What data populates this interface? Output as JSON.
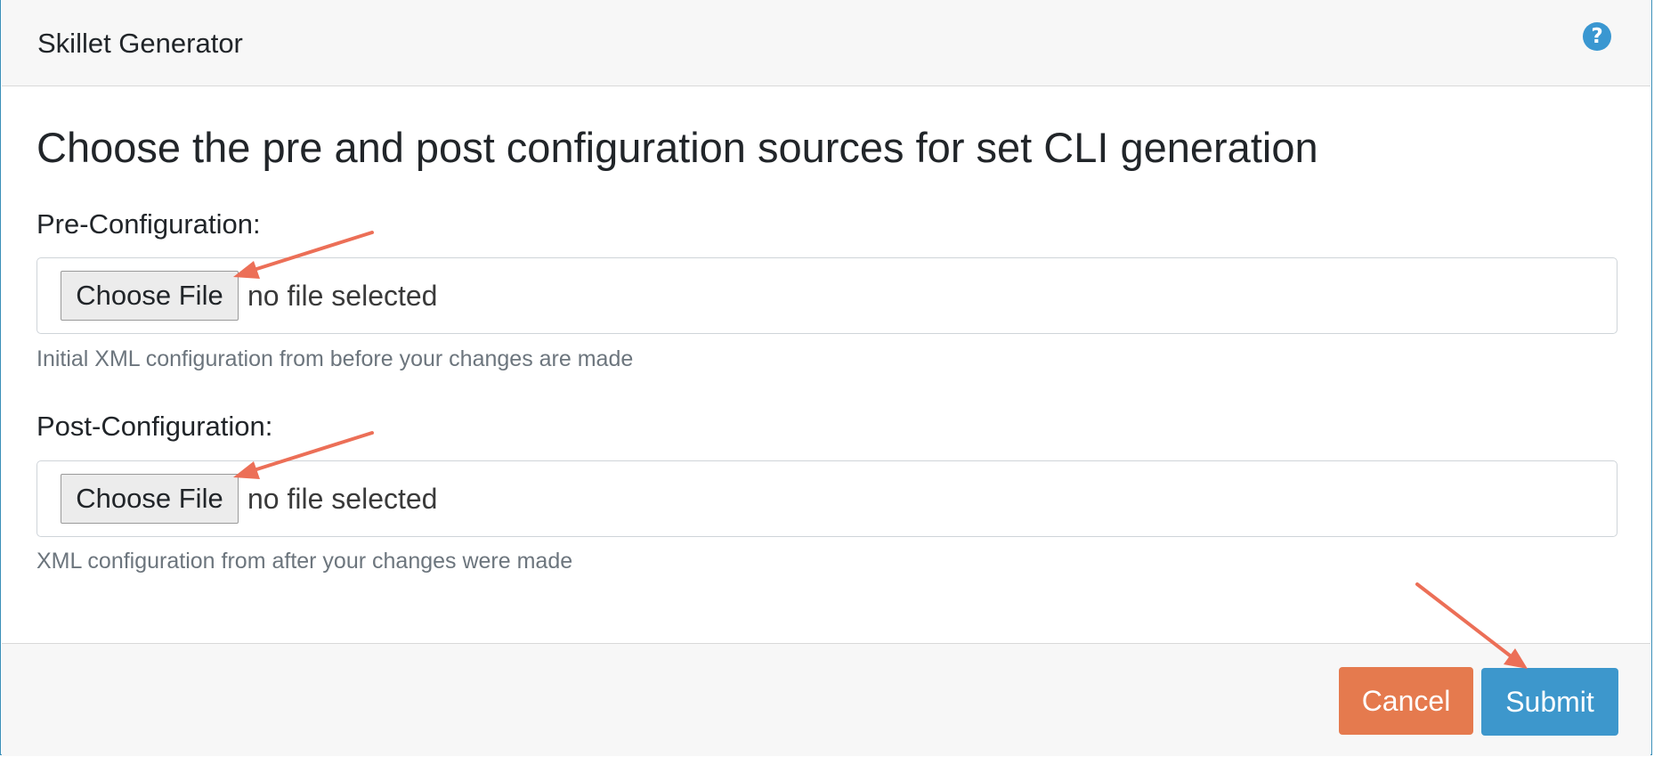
{
  "header": {
    "title": "Skillet Generator",
    "help_icon": "question-circle-icon",
    "help_glyph": "?"
  },
  "main": {
    "heading": "Choose the pre and post configuration sources for set CLI generation",
    "fields": [
      {
        "label": "Pre-Configuration:",
        "button_label": "Choose File",
        "file_status": "no file selected",
        "help": "Initial XML configuration from before your changes are made"
      },
      {
        "label": "Post-Configuration:",
        "button_label": "Choose File",
        "file_status": "no file selected",
        "help": "XML configuration from after your changes were made"
      }
    ]
  },
  "footer": {
    "cancel_label": "Cancel",
    "submit_label": "Submit"
  },
  "colors": {
    "accent_blue": "#3d97cc",
    "cancel_orange": "#e57a4e",
    "annotation_arrow": "#ec6f57"
  }
}
